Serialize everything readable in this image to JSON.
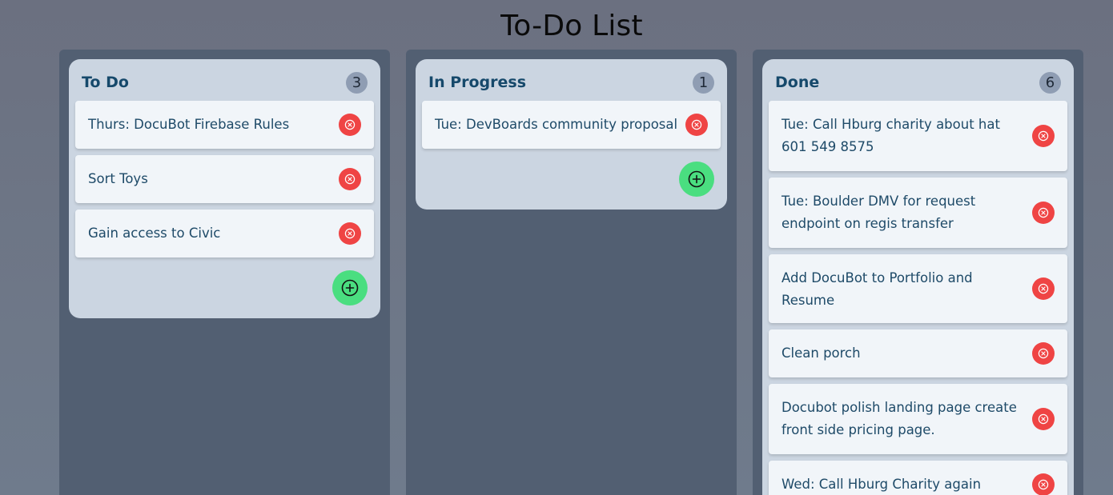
{
  "page": {
    "title": "To-Do List"
  },
  "columns": {
    "todo": {
      "title": "To Do",
      "count": "3",
      "tasks": [
        "Thurs: DocuBot Firebase Rules",
        "Sort Toys",
        "Gain access to Civic"
      ]
    },
    "in_progress": {
      "title": "In Progress",
      "count": "1",
      "tasks": [
        "Tue: DevBoards community proposal"
      ]
    },
    "done": {
      "title": "Done",
      "count": "6",
      "tasks": [
        "Tue: Call Hburg charity about hat 601 549 8575",
        "Tue: Boulder DMV for request endpoint on regis transfer",
        "Add DocuBot to Portfolio and Resume",
        "Clean porch",
        "Docubot polish landing page create front side pricing page.",
        "Wed: Call Hburg Charity again"
      ]
    }
  },
  "icons": {
    "delete": "close-circle-icon",
    "add": "plus-circle-icon"
  },
  "colors": {
    "delete_button": "#ef4444",
    "add_button": "#4ade80",
    "column_background": "#525f72",
    "panel_background": "#cbd5e1",
    "card_background": "#f1f5f9",
    "heading_text": "#16496b"
  }
}
